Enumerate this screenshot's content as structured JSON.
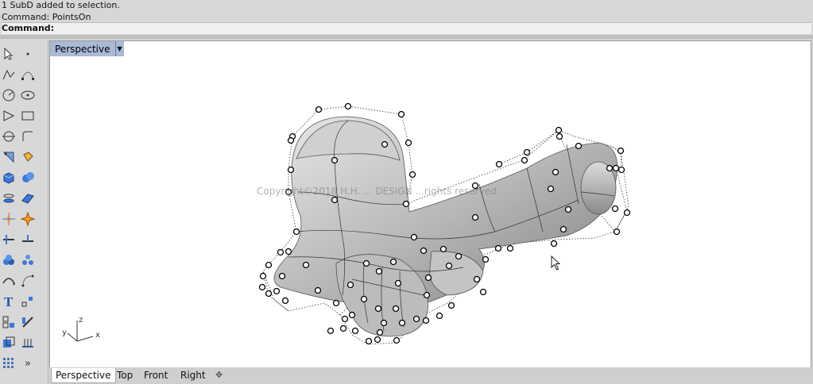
{
  "command_history": {
    "line1": "1 SubD added to selection.",
    "line2": "Command:  PointsOn",
    "prompt": "Command:"
  },
  "viewport": {
    "title": "Perspective",
    "watermark": "Copyright©2018 H.H. ... DESIGN  ...rights reserved",
    "axis": {
      "x": "x",
      "y": "y",
      "z": "z"
    }
  },
  "tabs": [
    "Perspective",
    "Top",
    "Front",
    "Right"
  ],
  "add_tab_symbol": "✥",
  "toolbar_more": "»",
  "colors": {
    "viewport_title_bg": "#a9bad6",
    "viewport_bg": "#ffffff",
    "model_gray": "#a8a8a8"
  },
  "toolbar_icons": [
    "select-arrow-icon",
    "point-icon",
    "polyline-icon",
    "curve-cv-icon",
    "circle-icon",
    "ellipse-icon",
    "polygon-icon",
    "rectangle-icon",
    "arc-icon",
    "trim-icon",
    "fillet-icon",
    "extrude-icon",
    "box-icon",
    "sphere-icon",
    "cylinder-icon",
    "plane-icon",
    "gumball-icon",
    "explode-icon",
    "split-icon",
    "boolean-icon",
    "group-icon",
    "points-on-icon",
    "curve-from-object-icon",
    "offset-icon",
    "text-icon",
    "dimension-icon",
    "transform-icon",
    "snap-icon",
    "render-icon",
    "lights-icon",
    "grid-icon",
    "more-icon"
  ]
}
